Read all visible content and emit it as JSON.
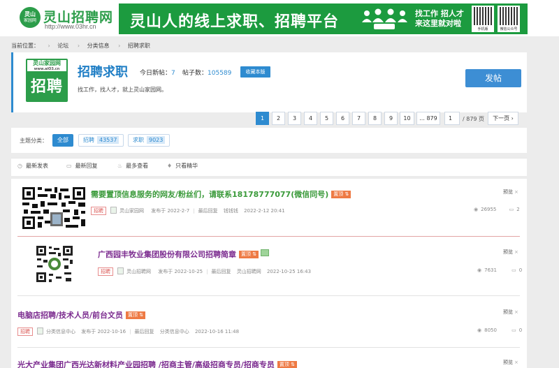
{
  "header": {
    "logo_badge_top": "灵山",
    "logo_badge_bottom": "家园网",
    "logo_title": "灵山招聘网",
    "logo_url": "http://www.03hr.cn",
    "banner_main": "灵山人的线上求职、招聘平台",
    "banner_side_1": "找工作 招人才",
    "banner_side_2": "来这里就对啦",
    "qr1_label": "手机版",
    "qr2_label": "微信公众号"
  },
  "breadcrumb": {
    "label": "当前位置：",
    "items": [
      "论坛",
      "分类信息",
      "招聘求职"
    ]
  },
  "forum": {
    "logo_top": "灵山家园网",
    "logo_url": "www.aiO3.cn",
    "logo_big": "招聘",
    "title": "招聘求职",
    "today_label": "今日新帖：",
    "today_value": "7",
    "posts_label": "帖子数：",
    "posts_value": "105589",
    "fav_label": "收藏本版",
    "desc": "找工作，找人才，就上灵山家园网。",
    "post_button": "发帖"
  },
  "pagination": {
    "pages": [
      "1",
      "2",
      "3",
      "4",
      "5",
      "6",
      "7",
      "8",
      "9",
      "10",
      "... 879"
    ],
    "current": "1",
    "jump_value": "1",
    "total": "/ 879 页",
    "next": "下一页"
  },
  "filter": {
    "label": "主题分类：",
    "all": "全部",
    "cat1": "招聘",
    "cat1_count": "43537",
    "cat2": "求职",
    "cat2_count": "9023"
  },
  "tabs": [
    "最新发表",
    "最新回复",
    "最多查看",
    "只看精华"
  ],
  "threads": [
    {
      "title": "需要置顶信息服务的网友/粉丝们，请联系18178777077(微信同号)",
      "badge": "置顶",
      "tag": "招聘",
      "author": "灵山家园网",
      "posted": "发布于 2022-2-7",
      "last_label": "最后回复",
      "last_user": "钱钱钱",
      "last_time": "2022-2-12 20:41",
      "views": "26955",
      "replies": "2",
      "preview": "预览"
    },
    {
      "title": "广西园丰牧业集团股份有限公司招聘简章",
      "badge": "置顶",
      "tag": "招聘",
      "author": "灵山招聘网",
      "posted": "发布于 2022-10-25",
      "last_label": "最后回复",
      "last_user": "灵山招聘网",
      "last_time": "2022-10-25 16:43",
      "views": "7631",
      "replies": "0",
      "preview": "预览"
    },
    {
      "title": "电脑店招聘/技术人员/前台文员",
      "badge": "置顶",
      "tag": "招聘",
      "author": "分类信息中心",
      "posted": "发布于 2022-10-16",
      "last_label": "最后回复",
      "last_user": "分类信息中心",
      "last_time": "2022-10-16 11:48",
      "views": "8050",
      "replies": "0",
      "preview": "预览"
    },
    {
      "title": "光大产业集团广西光达新材料产业园招聘 /招商主管/高级招商专员/招商专员",
      "badge": "置顶",
      "preview": "预览"
    }
  ],
  "colors": {
    "brand_green": "#2c9d4a",
    "accent_blue": "#2e8bd0",
    "top_badge": "#ee7a44",
    "title_green": "#3a9a3a",
    "title_purple": "#7b2b8f"
  }
}
